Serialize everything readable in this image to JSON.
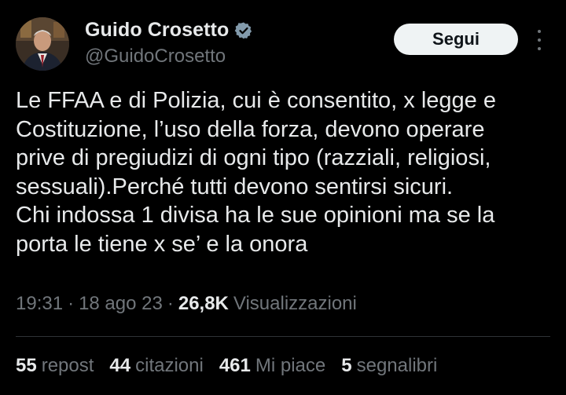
{
  "author": {
    "display_name": "Guido Crosetto",
    "handle": "@GuidoCrosetto",
    "verified_icon": "verified-badge-icon",
    "badge_color": "#829aab"
  },
  "actions": {
    "follow_label": "Segui",
    "more_icon": "more-vertical-icon"
  },
  "tweet": {
    "text": "Le FFAA e di Polizia, cui è consentito, x legge e\nCostituzione, l’uso della forza, devono operare\nprive di pregiudizi di ogni tipo (razziali, religiosi,\nsessuali).Perché tutti devono sentirsi sicuri.\nChi indossa 1 divisa ha le sue opinioni ma se la\nporta le tiene x se’ e la onora"
  },
  "meta": {
    "time": "19:31",
    "date": "18 ago 23",
    "separator": "·",
    "views_count": "26,8K",
    "views_label": "Visualizzazioni"
  },
  "stats": [
    {
      "count": "55",
      "label": "repost"
    },
    {
      "count": "44",
      "label": "citazioni"
    },
    {
      "count": "461",
      "label": "Mi piace"
    },
    {
      "count": "5",
      "label": "segnalibri"
    }
  ],
  "colors": {
    "background": "#000000",
    "primary_text": "#e7e9ea",
    "secondary_text": "#71767b",
    "divider": "#2f3336",
    "button_bg": "#eff3f4"
  }
}
